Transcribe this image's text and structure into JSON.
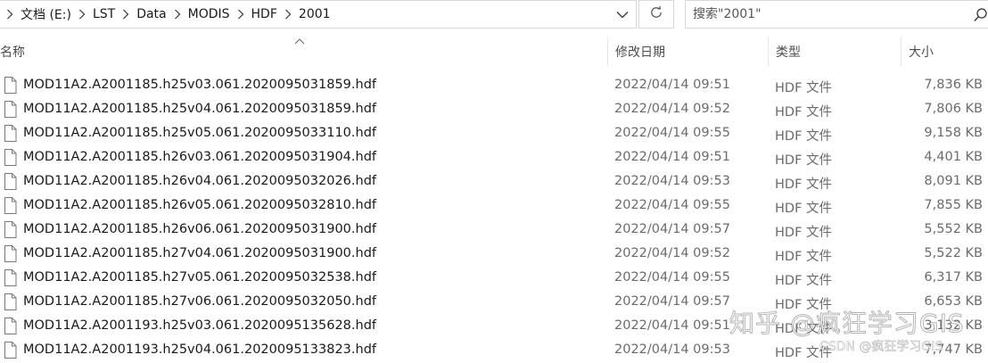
{
  "address_bar": {
    "crumbs": [
      "文档 (E:)",
      "LST",
      "Data",
      "MODIS",
      "HDF",
      "2001"
    ]
  },
  "search": {
    "placeholder": "搜索\"2001\""
  },
  "columns": {
    "name": "名称",
    "date": "修改日期",
    "type": "类型",
    "size": "大小"
  },
  "files": [
    {
      "name": "MOD11A2.A2001185.h25v03.061.2020095031859.hdf",
      "date": "2022/04/14 09:51",
      "type": "HDF 文件",
      "size": "7,836 KB"
    },
    {
      "name": "MOD11A2.A2001185.h25v04.061.2020095031859.hdf",
      "date": "2022/04/14 09:52",
      "type": "HDF 文件",
      "size": "7,806 KB"
    },
    {
      "name": "MOD11A2.A2001185.h25v05.061.2020095033110.hdf",
      "date": "2022/04/14 09:55",
      "type": "HDF 文件",
      "size": "9,158 KB"
    },
    {
      "name": "MOD11A2.A2001185.h26v03.061.2020095031904.hdf",
      "date": "2022/04/14 09:51",
      "type": "HDF 文件",
      "size": "4,401 KB"
    },
    {
      "name": "MOD11A2.A2001185.h26v04.061.2020095032026.hdf",
      "date": "2022/04/14 09:53",
      "type": "HDF 文件",
      "size": "8,091 KB"
    },
    {
      "name": "MOD11A2.A2001185.h26v05.061.2020095032810.hdf",
      "date": "2022/04/14 09:55",
      "type": "HDF 文件",
      "size": "7,855 KB"
    },
    {
      "name": "MOD11A2.A2001185.h26v06.061.2020095031900.hdf",
      "date": "2022/04/14 09:57",
      "type": "HDF 文件",
      "size": "5,552 KB"
    },
    {
      "name": "MOD11A2.A2001185.h27v04.061.2020095031900.hdf",
      "date": "2022/04/14 09:52",
      "type": "HDF 文件",
      "size": "5,522 KB"
    },
    {
      "name": "MOD11A2.A2001185.h27v05.061.2020095032538.hdf",
      "date": "2022/04/14 09:55",
      "type": "HDF 文件",
      "size": "6,317 KB"
    },
    {
      "name": "MOD11A2.A2001185.h27v06.061.2020095032050.hdf",
      "date": "2022/04/14 09:57",
      "type": "HDF 文件",
      "size": "6,653 KB"
    },
    {
      "name": "MOD11A2.A2001193.h25v03.061.2020095135628.hdf",
      "date": "2022/04/14 09:51",
      "type": "HDF 文件",
      "size": "3,132 KB"
    },
    {
      "name": "MOD11A2.A2001193.h25v04.061.2020095133823.hdf",
      "date": "2022/04/14 09:53",
      "type": "HDF 文件",
      "size": "7,747 KB"
    }
  ],
  "watermark": {
    "main": "知乎 @疯狂学习GIS",
    "sub": "CSDN @疯狂学习GIS"
  },
  "icons": {
    "breadcrumb_separator": "chevron-right-icon",
    "address_dropdown": "chevron-down-icon",
    "refresh": "refresh-icon",
    "search": "search-icon",
    "sort": "sort-ascending-icon",
    "file": "file-icon"
  },
  "colors": {
    "border": "#d9d9d9",
    "secondary_text": "#6b6b6b"
  }
}
